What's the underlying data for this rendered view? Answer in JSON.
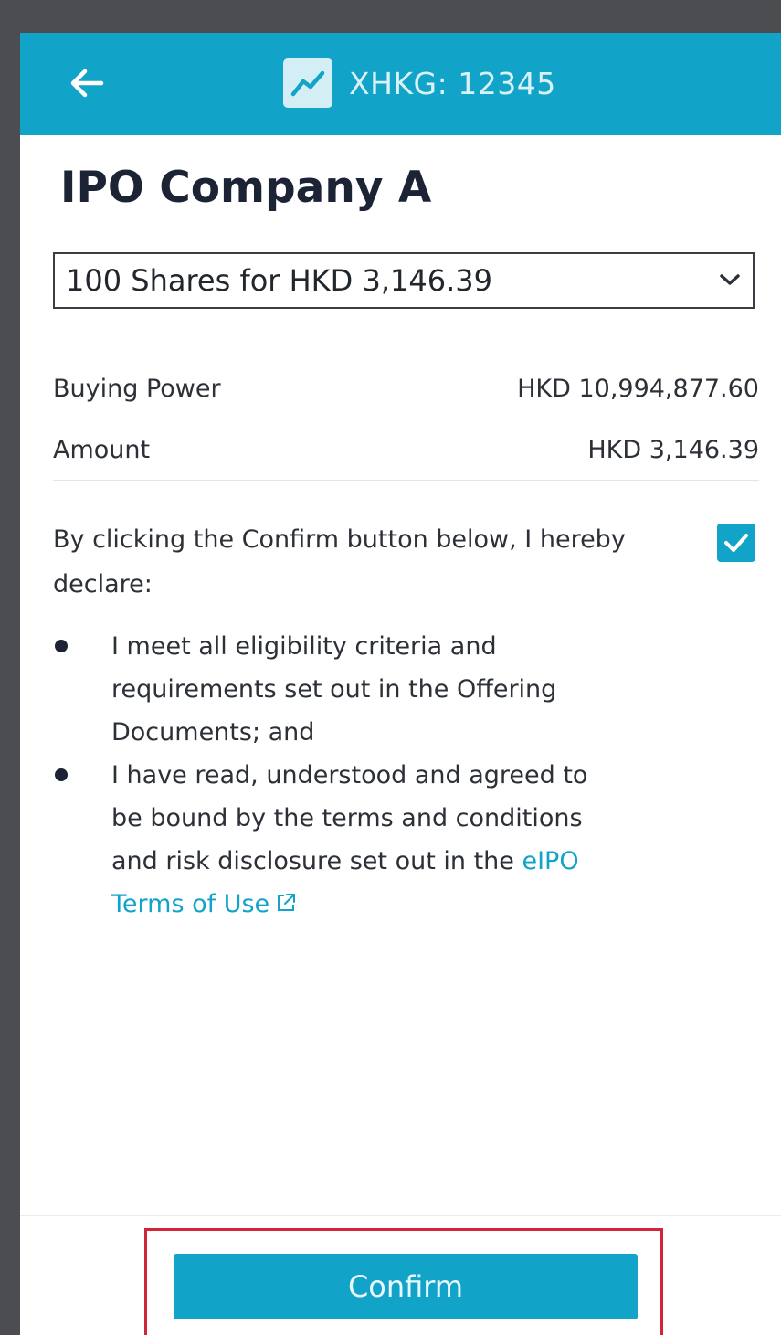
{
  "header": {
    "back_icon": "arrow-left-icon",
    "ticker_icon": "chart-line-icon",
    "ticker": "XHKG: 12345"
  },
  "title": "IPO Company A",
  "share_select": {
    "selected": "100 Shares for HKD 3,146.39",
    "icon": "chevron-down-icon"
  },
  "summary": {
    "buying_power_label": "Buying Power",
    "buying_power_value": "HKD 10,994,877.60",
    "amount_label": "Amount",
    "amount_value": "HKD 3,146.39"
  },
  "declaration": {
    "intro": "By clicking the Confirm button below, I hereby declare:",
    "checked": true,
    "bullet1": "I meet all eligibility criteria and requirements set out in the Offering Documents; and",
    "bullet2_text": "I have read, understood and agreed to be bound by the terms and conditions and risk disclosure set out in the ",
    "bullet2_link": "eIPO Terms of Use"
  },
  "confirm_label": "Confirm",
  "colors": {
    "accent": "#12a3c9",
    "highlight": "#d0253b"
  }
}
